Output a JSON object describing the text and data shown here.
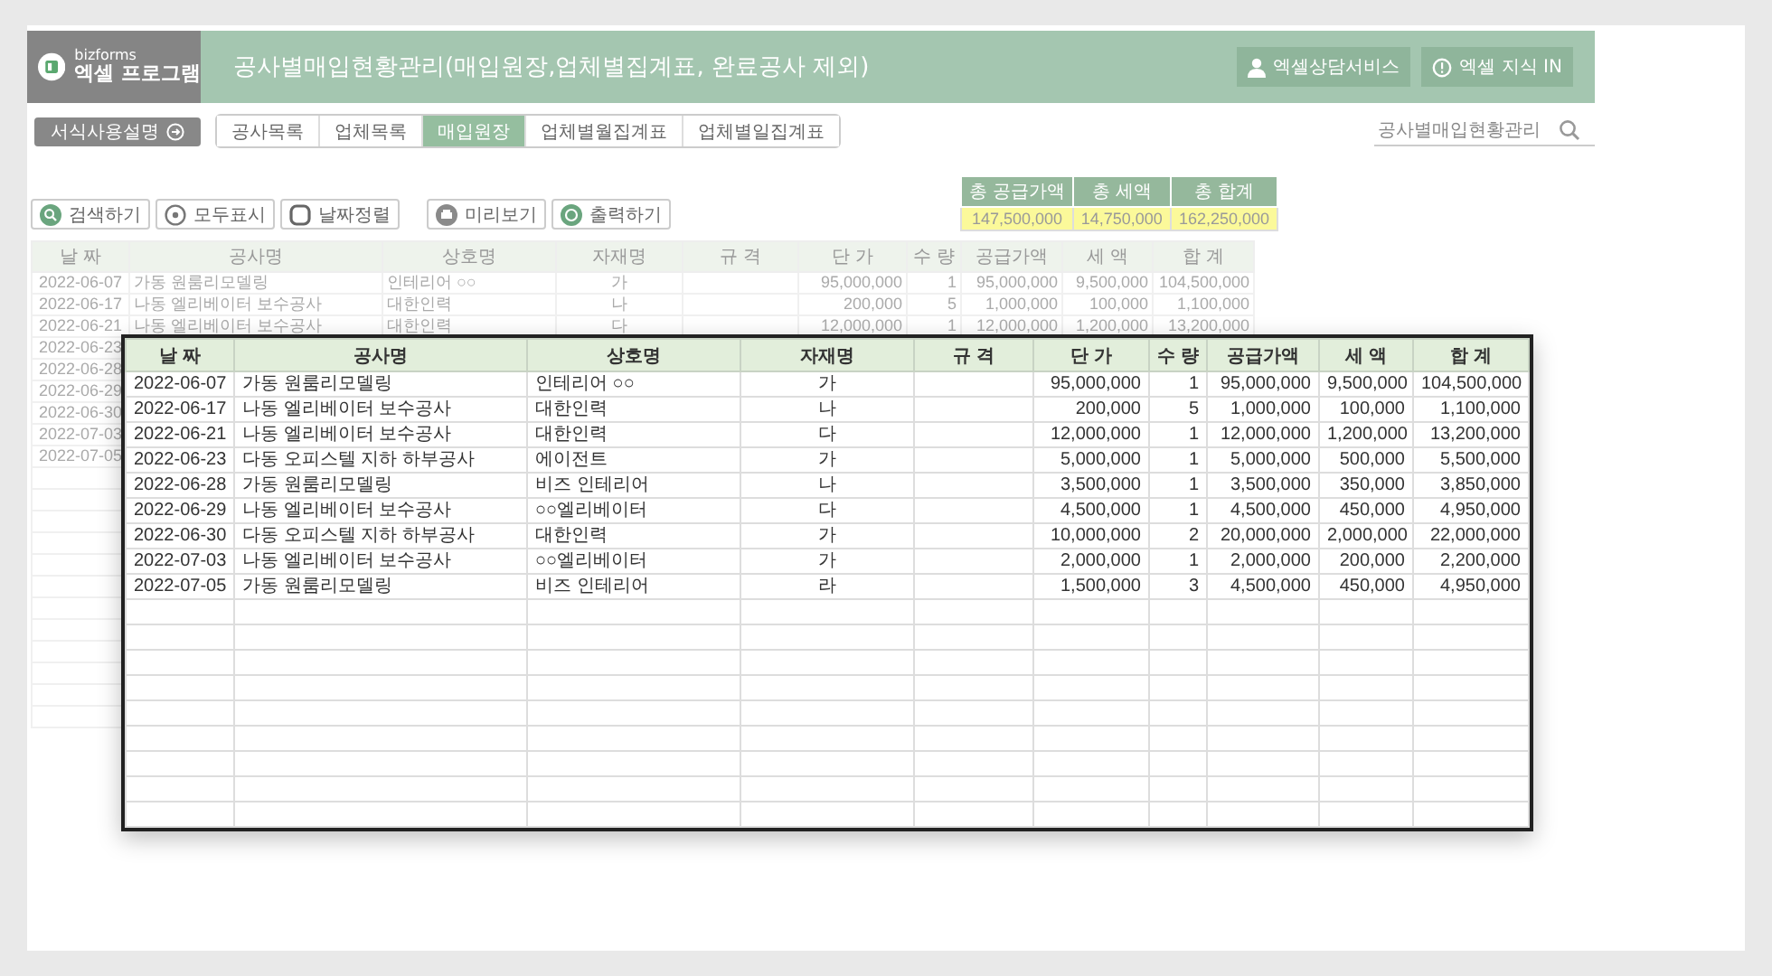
{
  "header": {
    "brand": "bizforms",
    "product": "엑셀 프로그램",
    "title": "공사별매입현황관리(매입원장,업체별집계표, 완료공사 제외)",
    "buttons": [
      "엑셀상담서비스",
      "엑셀 지식 IN"
    ]
  },
  "nav": {
    "guide_button": "서식사용설명",
    "tabs": [
      {
        "label": "공사목록",
        "selected": false
      },
      {
        "label": "업체목록",
        "selected": false
      },
      {
        "label": "매입원장",
        "selected": true
      },
      {
        "label": "업체별월집계표",
        "selected": false
      },
      {
        "label": "업체별일집계표",
        "selected": false
      }
    ],
    "search": {
      "placeholder": "공사별매입현황관리"
    }
  },
  "toolbar": [
    "검색하기",
    "모두표시",
    "날짜정렬",
    "미리보기",
    "출력하기"
  ],
  "summary": {
    "columns": [
      "총 공급가액",
      "총 세액",
      "총 합계"
    ],
    "values": [
      "147,500,000",
      "14,750,000",
      "162,250,000"
    ]
  },
  "sheet": {
    "columns": [
      "날 짜",
      "공사명",
      "상호명",
      "자재명",
      "규 격",
      "단 가",
      "수 량",
      "공급가액",
      "세 액",
      "합 계"
    ],
    "rows": [
      {
        "date": "2022-06-07",
        "project": "가동 원룸리모델링",
        "vendor": "인테리어 ○○",
        "material": "가",
        "unit_price": "95,000,000",
        "qty": "1",
        "supply": "95,000,000",
        "tax": "9,500,000",
        "total": "104,500,000"
      },
      {
        "date": "2022-06-17",
        "project": "나동 엘리베이터 보수공사",
        "vendor": "대한인력",
        "material": "나",
        "unit_price": "200,000",
        "qty": "5",
        "supply": "1,000,000",
        "tax": "100,000",
        "total": "1,100,000"
      },
      {
        "date": "2022-06-21",
        "project": "나동 엘리베이터 보수공사",
        "vendor": "대한인력",
        "material": "다",
        "unit_price": "12,000,000",
        "qty": "1",
        "supply": "12,000,000",
        "tax": "1,200,000",
        "total": "13,200,000"
      },
      {
        "date": "2022-06-23"
      },
      {
        "date": "2022-06-28"
      },
      {
        "date": "2022-06-29"
      },
      {
        "date": "2022-06-30"
      },
      {
        "date": "2022-07-03"
      },
      {
        "date": "2022-07-05"
      }
    ]
  },
  "zoomed_table": {
    "columns": [
      "날 짜",
      "공사명",
      "상호명",
      "자재명",
      "규 격",
      "단 가",
      "수 량",
      "공급가액",
      "세 액",
      "합 계"
    ],
    "rows": [
      {
        "date": "2022-06-07",
        "project": "가동 원룸리모델링",
        "vendor": "인테리어 ○○",
        "material": "가",
        "unit_price": "95,000,000",
        "qty": "1",
        "supply": "95,000,000",
        "tax": "9,500,000",
        "total": "104,500,000"
      },
      {
        "date": "2022-06-17",
        "project": "나동 엘리베이터 보수공사",
        "vendor": "대한인력",
        "material": "나",
        "unit_price": "200,000",
        "qty": "5",
        "supply": "1,000,000",
        "tax": "100,000",
        "total": "1,100,000"
      },
      {
        "date": "2022-06-21",
        "project": "나동 엘리베이터 보수공사",
        "vendor": "대한인력",
        "material": "다",
        "unit_price": "12,000,000",
        "qty": "1",
        "supply": "12,000,000",
        "tax": "1,200,000",
        "total": "13,200,000"
      },
      {
        "date": "2022-06-23",
        "project": "다동 오피스텔 지하 하부공사",
        "vendor": "에이전트",
        "material": "가",
        "unit_price": "5,000,000",
        "qty": "1",
        "supply": "5,000,000",
        "tax": "500,000",
        "total": "5,500,000"
      },
      {
        "date": "2022-06-28",
        "project": "가동 원룸리모델링",
        "vendor": "비즈 인테리어",
        "material": "나",
        "unit_price": "3,500,000",
        "qty": "1",
        "supply": "3,500,000",
        "tax": "350,000",
        "total": "3,850,000"
      },
      {
        "date": "2022-06-29",
        "project": "나동 엘리베이터 보수공사",
        "vendor": "○○엘리베이터",
        "material": "다",
        "unit_price": "4,500,000",
        "qty": "1",
        "supply": "4,500,000",
        "tax": "450,000",
        "total": "4,950,000"
      },
      {
        "date": "2022-06-30",
        "project": "다동 오피스텔 지하 하부공사",
        "vendor": "대한인력",
        "material": "가",
        "unit_price": "10,000,000",
        "qty": "2",
        "supply": "20,000,000",
        "tax": "2,000,000",
        "total": "22,000,000"
      },
      {
        "date": "2022-07-03",
        "project": "나동 엘리베이터 보수공사",
        "vendor": "○○엘리베이터",
        "material": "가",
        "unit_price": "2,000,000",
        "qty": "1",
        "supply": "2,000,000",
        "tax": "200,000",
        "total": "2,200,000"
      },
      {
        "date": "2022-07-05",
        "project": "가동 원룸리모델링",
        "vendor": "비즈 인테리어",
        "material": "라",
        "unit_price": "1,500,000",
        "qty": "3",
        "supply": "4,500,000",
        "tax": "450,000",
        "total": "4,950,000"
      }
    ]
  }
}
